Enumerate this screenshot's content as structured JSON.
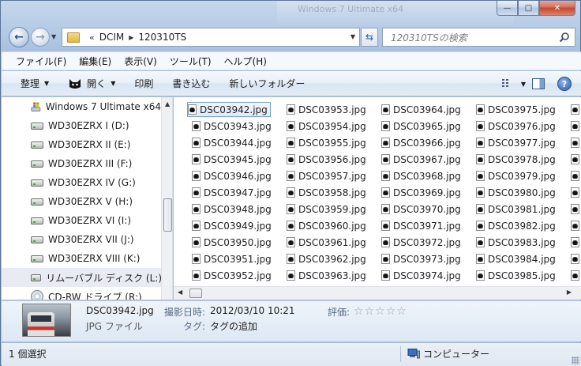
{
  "window": {
    "bg_window_text": "Windows 7 Ultimate x64",
    "minimize_glyph": "—",
    "maximize_glyph": "□",
    "close_glyph": "✕"
  },
  "address": {
    "overflow_glyph": "«",
    "crumbs": [
      "DCIM",
      "120310TS"
    ]
  },
  "search": {
    "placeholder": "120310TSの検索"
  },
  "menu": [
    "ファイル(F)",
    "編集(E)",
    "表示(V)",
    "ツール(T)",
    "ヘルプ(H)"
  ],
  "commands": {
    "organize": "整理",
    "open": "開く",
    "print": "印刷",
    "burn": "書き込む",
    "new_folder": "新しいフォルダー",
    "help": "?"
  },
  "nav_items": [
    {
      "label": "Windows 7 Ultimate x64",
      "icon": "windows-drive-icon"
    },
    {
      "label": "WD30EZRX I (D:)",
      "icon": "hard-drive-icon"
    },
    {
      "label": "WD30EZRX II (E:)",
      "icon": "hard-drive-icon"
    },
    {
      "label": "WD30EZRX III (F:)",
      "icon": "hard-drive-icon"
    },
    {
      "label": "WD30EZRX IV (G:)",
      "icon": "hard-drive-icon"
    },
    {
      "label": "WD30EZRX V (H:)",
      "icon": "hard-drive-icon"
    },
    {
      "label": "WD30EZRX VI (I:)",
      "icon": "hard-drive-icon"
    },
    {
      "label": "WD30EZRX VII (J:)",
      "icon": "hard-drive-icon"
    },
    {
      "label": "WD30EZRX VIII (K:)",
      "icon": "hard-drive-icon"
    },
    {
      "label": "リムーバブル ディスク (L:)",
      "icon": "removable-drive-icon"
    },
    {
      "label": "CD-RW ドライブ (R:)",
      "icon": "cd-drive-icon"
    }
  ],
  "files": {
    "columns": [
      [
        "DSC03942.jpg",
        "DSC03943.jpg",
        "DSC03944.jpg",
        "DSC03945.jpg",
        "DSC03946.jpg",
        "DSC03947.jpg",
        "DSC03948.jpg",
        "DSC03949.jpg",
        "DSC03950.jpg",
        "DSC03951.jpg",
        "DSC03952.jpg"
      ],
      [
        "DSC03953.jpg",
        "DSC03954.jpg",
        "DSC03955.jpg",
        "DSC03956.jpg",
        "DSC03957.jpg",
        "DSC03958.jpg",
        "DSC03959.jpg",
        "DSC03960.jpg",
        "DSC03961.jpg",
        "DSC03962.jpg",
        "DSC03963.jpg"
      ],
      [
        "DSC03964.jpg",
        "DSC03965.jpg",
        "DSC03966.jpg",
        "DSC03967.jpg",
        "DSC03968.jpg",
        "DSC03969.jpg",
        "DSC03970.jpg",
        "DSC03971.jpg",
        "DSC03972.jpg",
        "DSC03973.jpg",
        "DSC03974.jpg"
      ],
      [
        "DSC03975.jpg",
        "DSC03976.jpg",
        "DSC03977.jpg",
        "DSC03978.jpg",
        "DSC03979.jpg",
        "DSC03980.jpg",
        "DSC03981.jpg",
        "DSC03982.jpg",
        "DSC03983.jpg",
        "DSC03984.jpg",
        "DSC03985.jpg"
      ]
    ],
    "selected": "DSC03942.jpg"
  },
  "details": {
    "name": "DSC03942.jpg",
    "type": "JPG ファイル",
    "date_label": "撮影日時:",
    "date_value": "2012/03/10 10:21",
    "tags_label": "タグ:",
    "tags_value": "タグの追加",
    "rating_label": "評価:",
    "rating": 0,
    "rating_max": 5
  },
  "status": {
    "selection": "1 個選択",
    "location": "コンピューター"
  }
}
